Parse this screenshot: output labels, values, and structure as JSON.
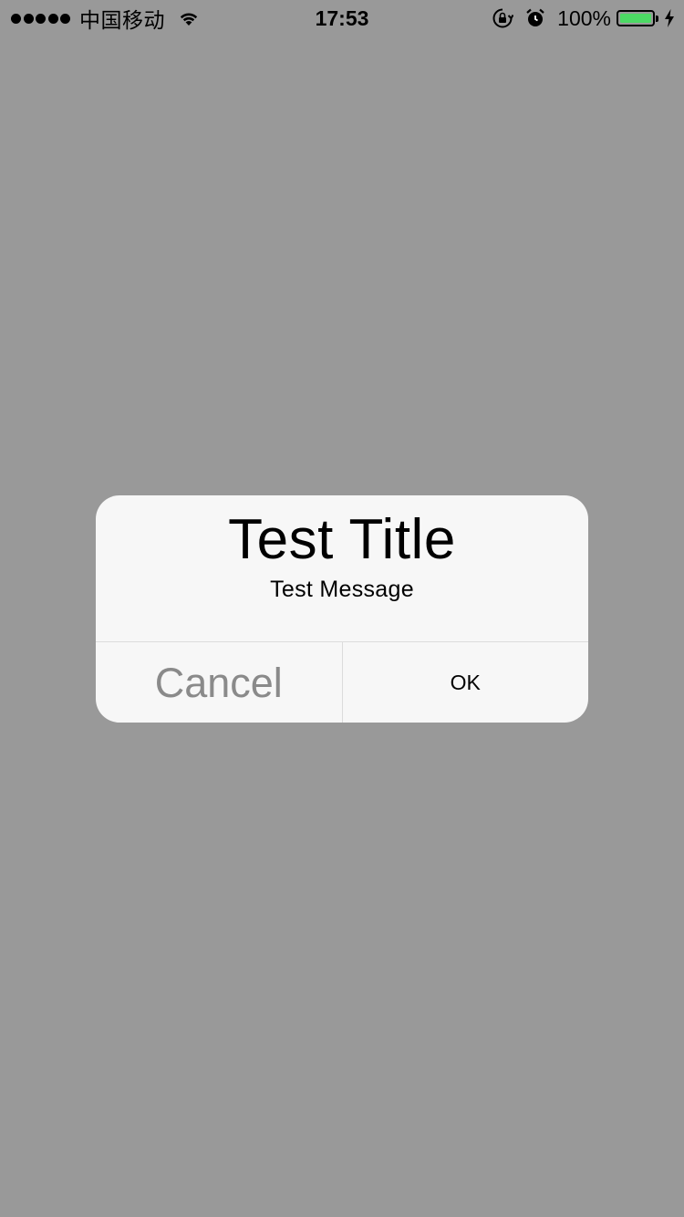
{
  "status_bar": {
    "carrier": "中国移动",
    "time": "17:53",
    "battery_percent": "100%",
    "battery_level": 1.0,
    "battery_color": "#4cd964",
    "signal_bars": 5,
    "icons": [
      "wifi-icon",
      "rotation-lock-icon",
      "alarm-icon",
      "battery-icon",
      "charging-bolt-icon"
    ]
  },
  "alert": {
    "title": "Test Title",
    "message": "Test Message",
    "cancel_label": "Cancel",
    "ok_label": "OK"
  },
  "colors": {
    "overlay_background": "#999999",
    "alert_background": "#f7f7f7",
    "cancel_text": "#8a8a8a"
  }
}
